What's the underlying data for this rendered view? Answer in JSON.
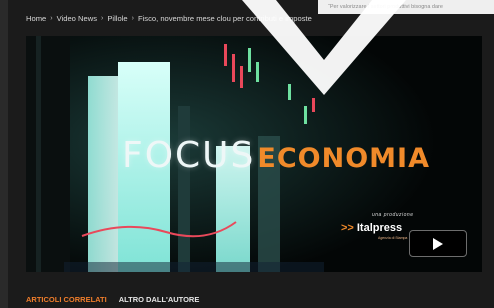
{
  "breadcrumb": {
    "items": [
      "Home",
      "Video News",
      "Pillole",
      "Fisco, novembre mese clou per contributi e imposte"
    ],
    "separator": "›"
  },
  "promo": {
    "text": "“Per valorizzare i settori produttivi bisogna dare"
  },
  "video": {
    "title_focus": "FOCUS",
    "title_economia": "ECONOMIA",
    "production_label": "una produzione",
    "brand_arrow": ">>",
    "brand_name": "Italpress",
    "brand_subtitle": "Agenzia di Stampa",
    "play_icon": "play-icon"
  },
  "tabs": {
    "related": "ARTICOLI CORRELATI",
    "author": "ALTRO DALL'AUTORE"
  },
  "colors": {
    "accent": "#f08a2a",
    "background": "#1b1b1b"
  }
}
